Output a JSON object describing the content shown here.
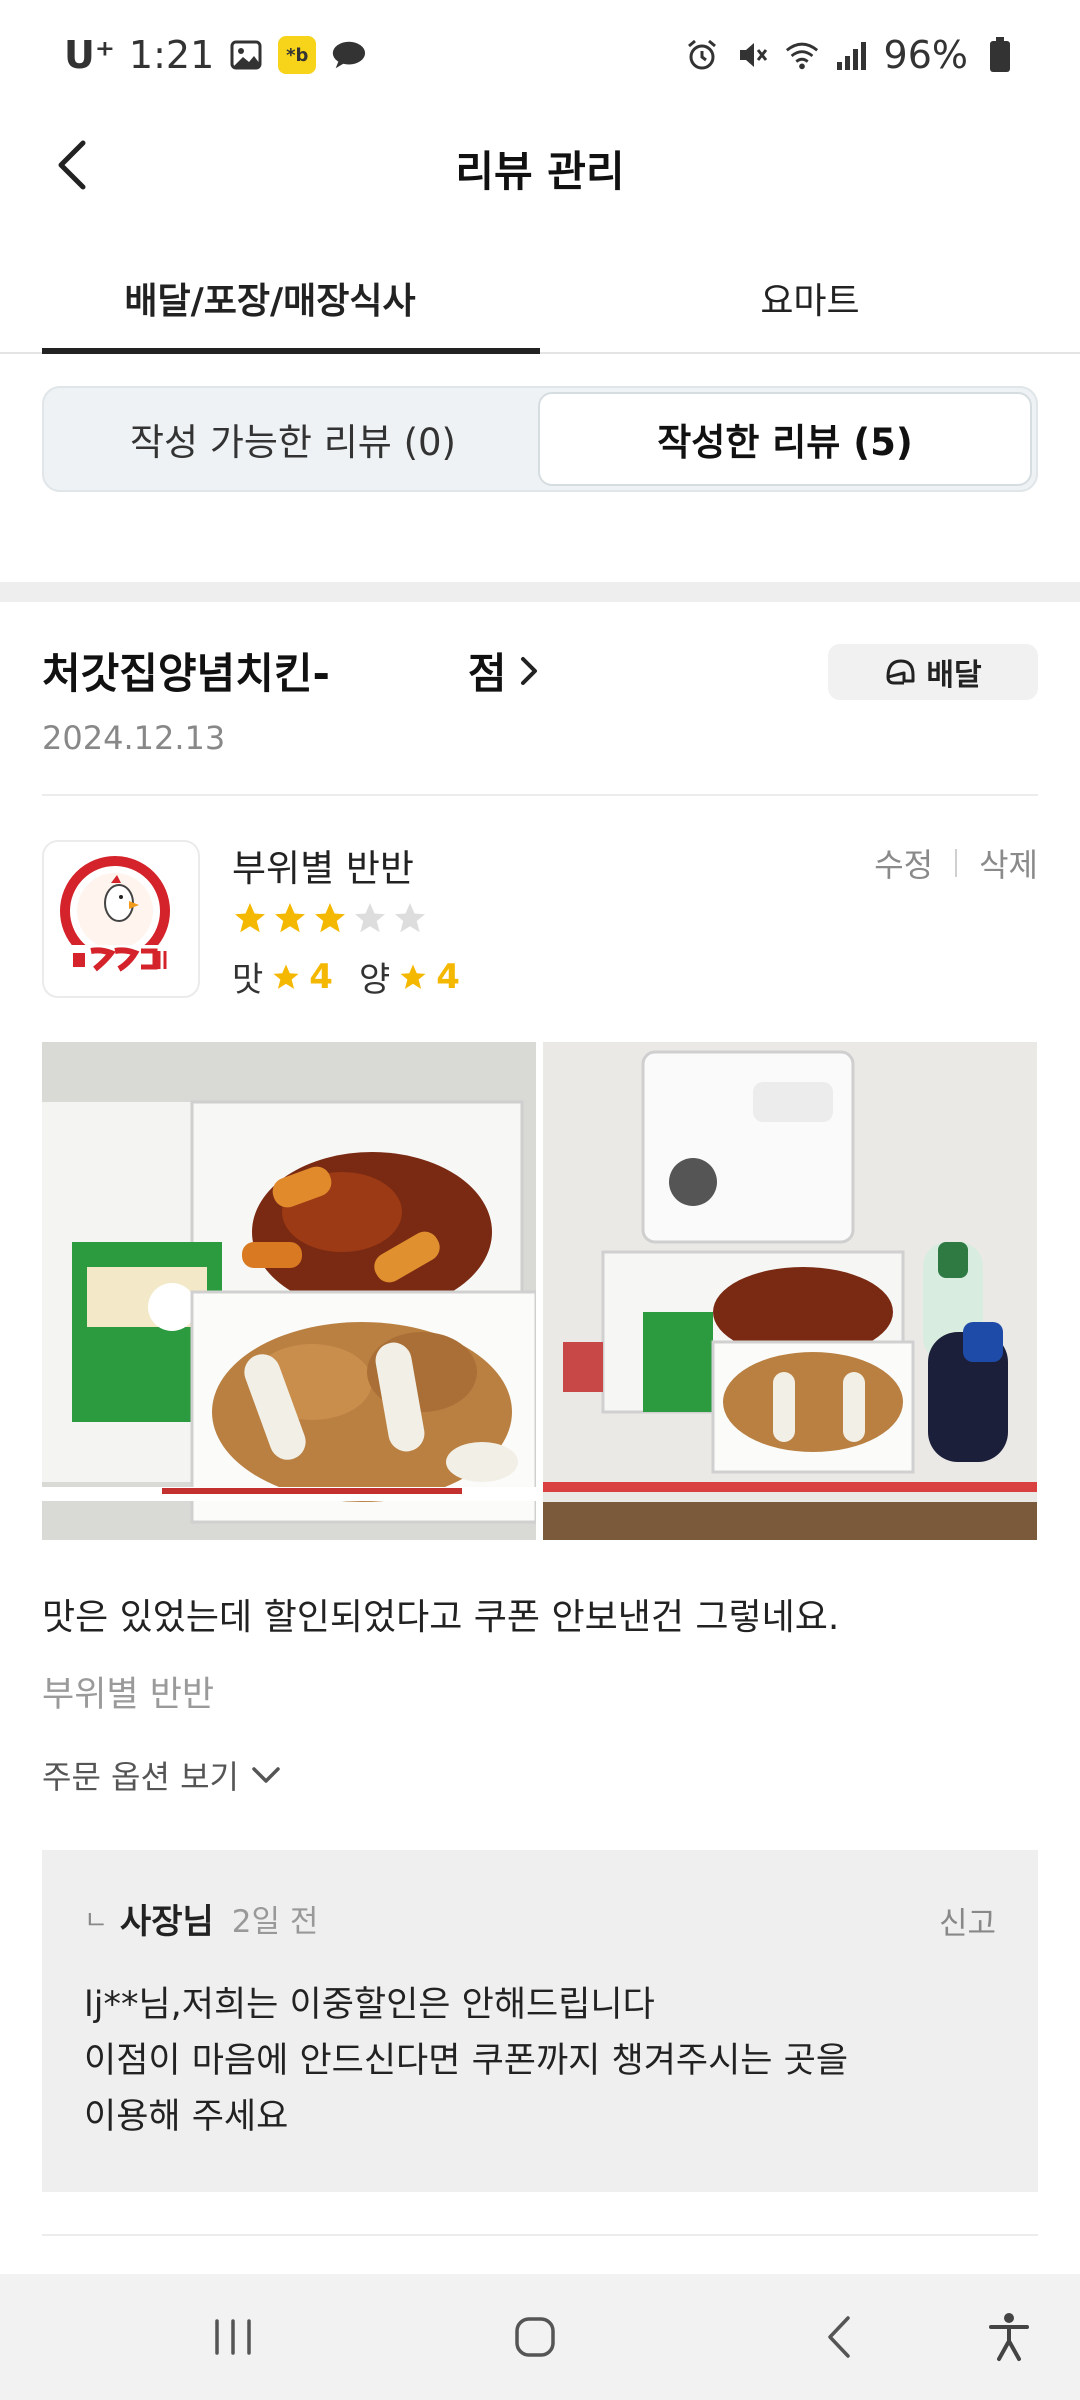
{
  "status_bar": {
    "carrier": "U⁺",
    "time": "1:21",
    "battery": "96%",
    "kakao_badge": "*b"
  },
  "header": {
    "title": "리뷰 관리"
  },
  "main_tabs": [
    {
      "label": "배달/포장/매장식사",
      "active": true
    },
    {
      "label": "요마트",
      "active": false
    }
  ],
  "segment": {
    "writable": "작성 가능한 리뷰 (0)",
    "written": "작성한 리뷰 (5)"
  },
  "store": {
    "name_part1": "처갓집양념치킨-",
    "name_part2": "점",
    "date": "2024.12.13",
    "delivery_badge": "배달"
  },
  "review": {
    "menu_name": "부위별 반반",
    "star_rating": 3,
    "star_max": 5,
    "taste_label": "맛",
    "taste_score": "4",
    "amount_label": "양",
    "amount_score": "4",
    "edit_label": "수정",
    "delete_label": "삭제",
    "text": "맛은 있었는데 할인되었다고 쿠폰 안보낸건 그렇네요.",
    "menu_line": "부위별 반반",
    "order_options_label": "주문 옵션 보기"
  },
  "reply": {
    "corner": "ㄴ",
    "author": "사장님",
    "time": "2일 전",
    "report_label": "신고",
    "line1": "lj**님,저희는 이중할인은 안해드립니다",
    "line2": "이점이 마음에 안드신다면 쿠폰까지 챙겨주시는 곳을",
    "line3": "이용해 주세요"
  },
  "colors": {
    "star": "#f5b800",
    "star_empty": "#dddddd",
    "accent_dark": "#222222"
  }
}
